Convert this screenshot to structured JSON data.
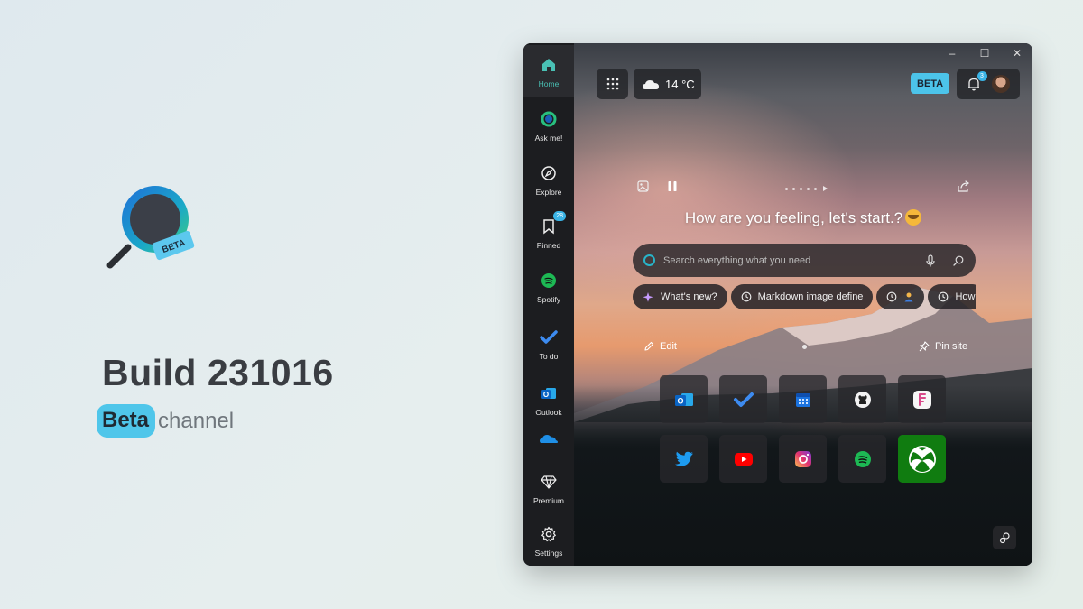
{
  "promo": {
    "logo_badge": "BETA",
    "build_title": "Build 231016",
    "channel_pill": "Beta",
    "channel_text": "channel"
  },
  "sidebar": {
    "items": [
      {
        "label": "Home",
        "icon": "home-icon"
      },
      {
        "label": "Ask me!",
        "icon": "copilot-icon"
      },
      {
        "label": "Explore",
        "icon": "compass-icon"
      },
      {
        "label": "Pinned",
        "icon": "bookmark-icon",
        "badge": "28"
      },
      {
        "label": "Spotify",
        "icon": "spotify-icon"
      },
      {
        "label": "To do",
        "icon": "todo-icon"
      },
      {
        "label": "Outlook",
        "icon": "outlook-icon"
      },
      {
        "label": "",
        "icon": "onedrive-icon"
      },
      {
        "label": "Premium",
        "icon": "diamond-icon"
      },
      {
        "label": "Settings",
        "icon": "gear-icon"
      }
    ]
  },
  "window_controls": {
    "minimize": "–",
    "maximize": "☐",
    "close": "✕"
  },
  "header": {
    "weather_temp": "14 °C",
    "beta_tag": "BETA",
    "notification_count": "3"
  },
  "greeting": "How are you feeling, let's start.?",
  "search": {
    "placeholder": "Search everything what you need"
  },
  "chips": [
    {
      "label": "What's new?",
      "icon": "sparkle-icon"
    },
    {
      "label": "Markdown image define",
      "icon": "history-icon"
    },
    {
      "label": "",
      "icon": "history-icon"
    },
    {
      "label": "How",
      "icon": "history-icon"
    }
  ],
  "actions": {
    "edit": "Edit",
    "pin_site": "Pin site"
  },
  "tiles": [
    {
      "name": "outlook",
      "icon": "outlook-icon"
    },
    {
      "name": "todo",
      "icon": "todo-icon"
    },
    {
      "name": "calendar",
      "icon": "calendar-icon"
    },
    {
      "name": "github",
      "icon": "github-icon"
    },
    {
      "name": "app",
      "icon": "app-icon"
    },
    {
      "name": "twitter",
      "icon": "twitter-icon"
    },
    {
      "name": "youtube",
      "icon": "youtube-icon"
    },
    {
      "name": "instagram",
      "icon": "instagram-icon"
    },
    {
      "name": "spotify",
      "icon": "spotify-icon"
    },
    {
      "name": "xbox",
      "icon": "xbox-icon"
    }
  ],
  "colors": {
    "accent": "#4fc6ea",
    "active_nav": "#49c0b4",
    "xbox": "#107c10"
  }
}
